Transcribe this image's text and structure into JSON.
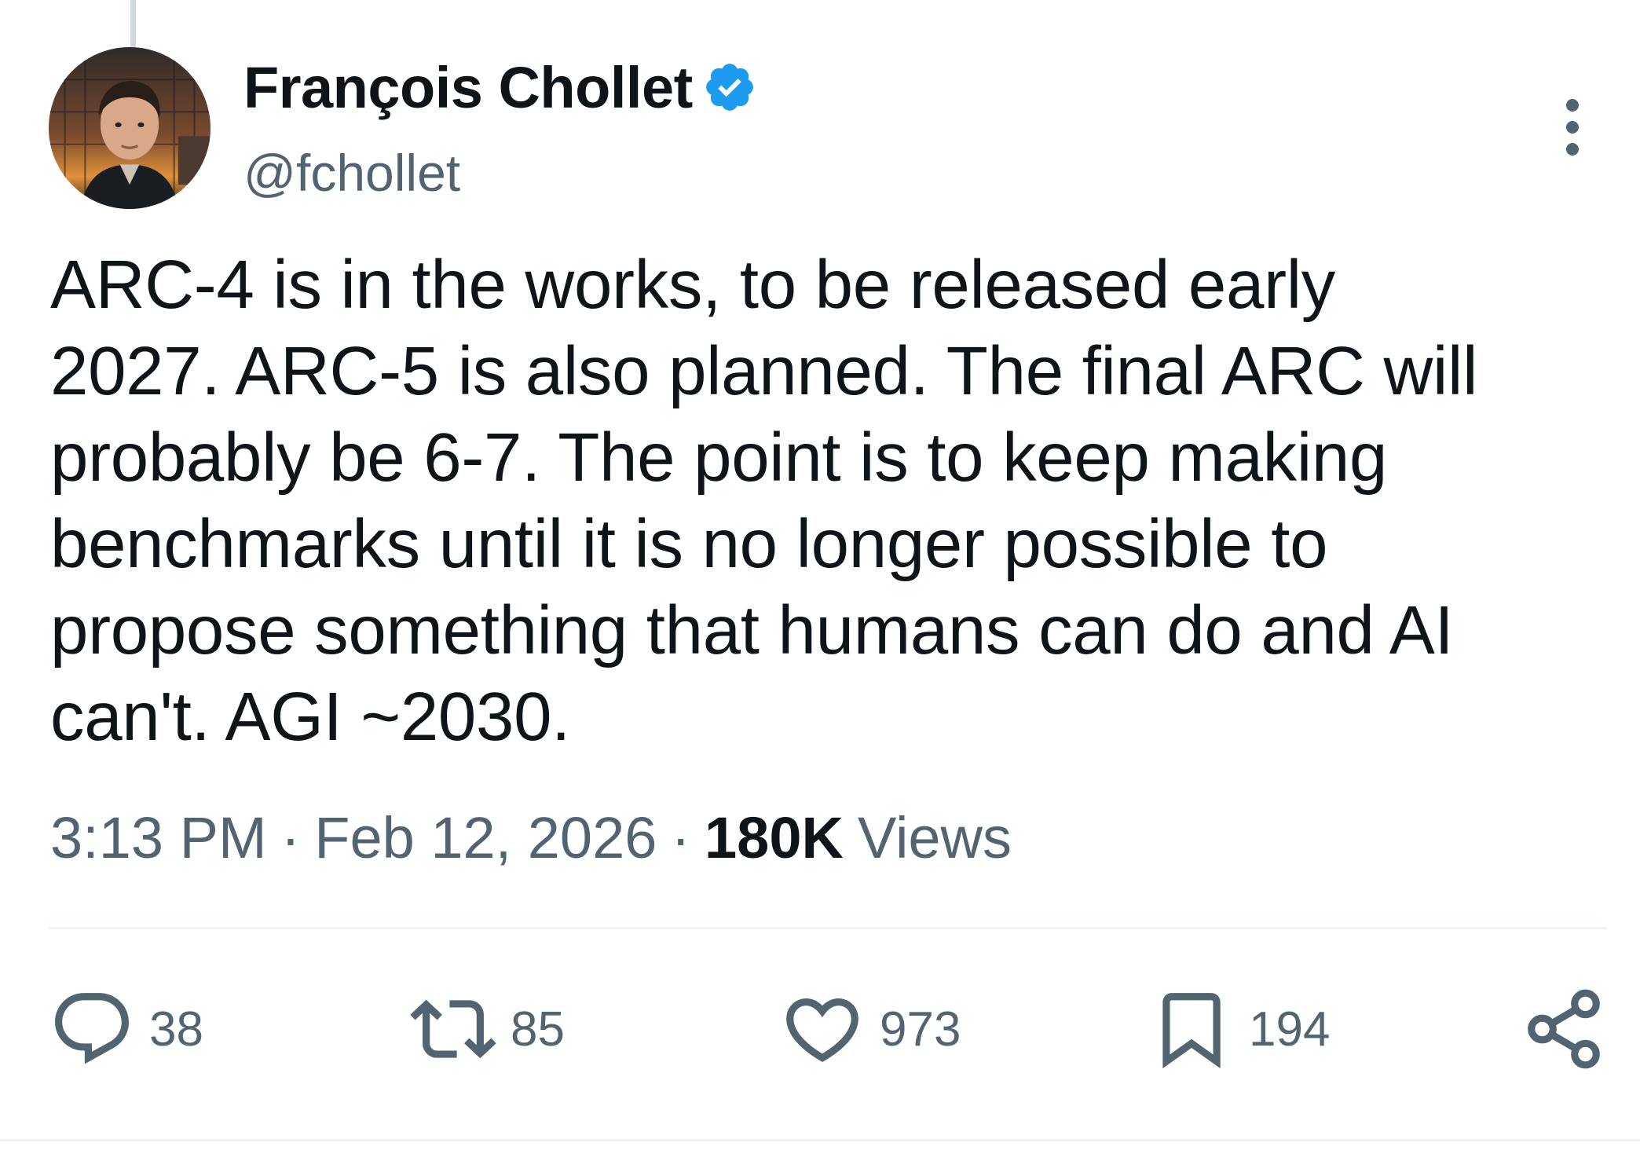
{
  "author": {
    "display_name": "François Chollet",
    "handle": "@fchollet",
    "verified": true,
    "verified_color": "#1d9bf0"
  },
  "tweet": {
    "text": "ARC-4 is in the works, to be released early\n2027. ARC-5 is also planned. The final ARC will\nprobably be 6-7. The point is to keep making\nbenchmarks until it is no longer possible to\npropose something that humans can do and AI\ncan't. AGI ~2030."
  },
  "meta": {
    "time": "3:13 PM",
    "separator": "·",
    "date": "Feb 12, 2026",
    "views_count": "180K",
    "views_label": "Views"
  },
  "actions": {
    "replies": "38",
    "reposts": "85",
    "likes": "973",
    "bookmarks": "194"
  },
  "icons": {
    "reply": "reply-icon",
    "repost": "repost-icon",
    "like": "heart-icon",
    "bookmark": "bookmark-icon",
    "share": "share-icon",
    "more": "more-icon"
  },
  "colors": {
    "text_primary": "#0f1419",
    "text_secondary": "#536471",
    "divider": "#eff3f4"
  }
}
